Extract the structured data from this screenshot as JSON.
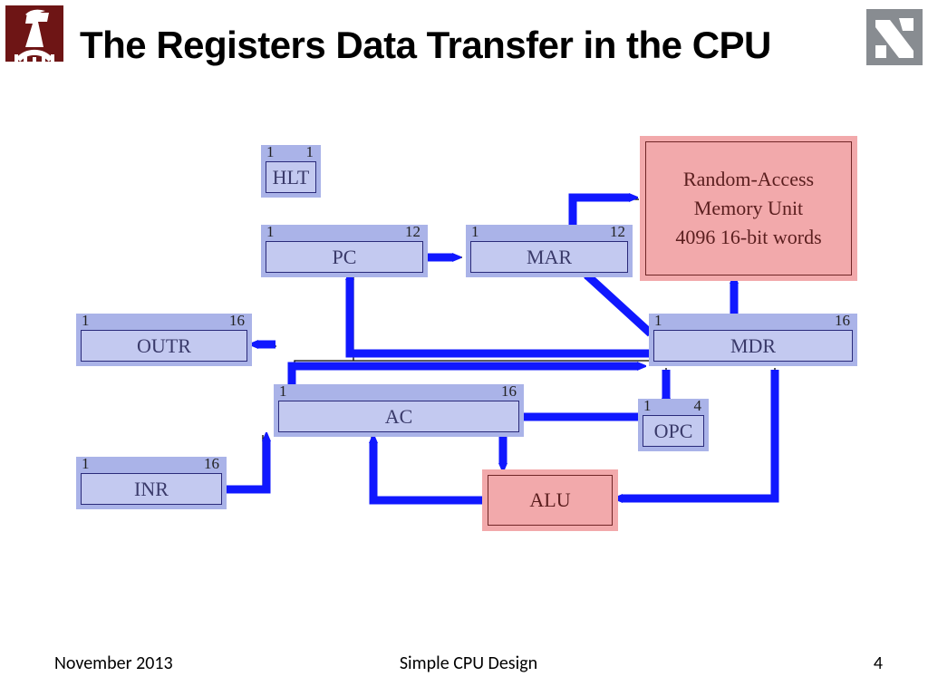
{
  "title": "The Registers Data Transfer in the CPU",
  "footer": {
    "date": "November 2013",
    "desc": "Simple CPU Design",
    "page": "4"
  },
  "blocks": {
    "HLT": {
      "label": "HLT",
      "left": "1",
      "right": "1"
    },
    "PC": {
      "label": "PC",
      "left": "1",
      "right": "12"
    },
    "MAR": {
      "label": "MAR",
      "left": "1",
      "right": "12"
    },
    "OUTR": {
      "label": "OUTR",
      "left": "1",
      "right": "16"
    },
    "MDR": {
      "label": "MDR",
      "left": "1",
      "right": "16"
    },
    "AC": {
      "label": "AC",
      "left": "1",
      "right": "16"
    },
    "OPC": {
      "label": "OPC",
      "left": "1",
      "right": "4"
    },
    "INR": {
      "label": "INR",
      "left": "1",
      "right": "16"
    }
  },
  "ram": {
    "line1": "Random-Access",
    "line2": "Memory Unit",
    "line3": "4096 16-bit words"
  },
  "alu": {
    "label": "ALU"
  },
  "connections": [
    "PC -> MAR",
    "MDR -> PC",
    "MDR -> MAR",
    "MDR <-> RAM (address via MAR)",
    "MDR -> OPC",
    "MDR -> ALU",
    "AC -> MDR",
    "AC -> ALU",
    "ALU -> AC",
    "AC -> OUTR",
    "INR -> AC"
  ]
}
